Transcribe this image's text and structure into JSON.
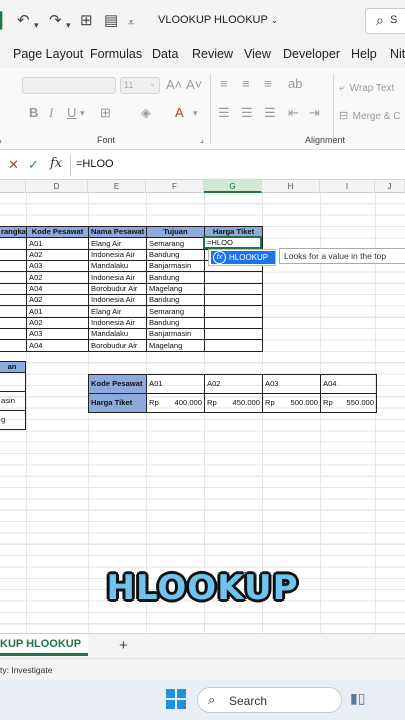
{
  "title_bar": {
    "doc_title": "VLOOKUP HLOOKUP",
    "search_icon": "search-icon"
  },
  "ribbon_tabs": [
    "Page Layout",
    "Formulas",
    "Data",
    "Review",
    "View",
    "Developer",
    "Help",
    "Nit"
  ],
  "ribbon": {
    "font_size_value": "11",
    "wrap_text_label": "Wrap Text",
    "merge_label": "Merge & C",
    "groups": {
      "font": "Font",
      "alignment": "Alignment"
    }
  },
  "formula_bar": {
    "content": "=HLOO"
  },
  "columns": [
    "D",
    "E",
    "F",
    "G",
    "H",
    "I",
    "J"
  ],
  "table1": {
    "headers": [
      "rangka",
      "Kode Pesawat",
      "Nama Pesawat",
      "Tujuan",
      "Harga Tiket"
    ],
    "rows": [
      [
        "A01",
        "Elang Air",
        "Semarang"
      ],
      [
        "A02",
        "Indonesia Air",
        "Bandung"
      ],
      [
        "A03",
        "Mandalaku",
        "Banjarmasin"
      ],
      [
        "A02",
        "Indonesia Air",
        "Bandung"
      ],
      [
        "A04",
        "Borobudur Air",
        "Magelang"
      ],
      [
        "A02",
        "Indonesia Air",
        "Bandung"
      ],
      [
        "A01",
        "Elang Air",
        "Semarang"
      ],
      [
        "A02",
        "Indonesia Air",
        "Bandung"
      ],
      [
        "A03",
        "Mandalaku",
        "Banjarmasin"
      ],
      [
        "A04",
        "Borobudur Air",
        "Magelang"
      ]
    ]
  },
  "active_cell_text": "=HLOO",
  "left_table": {
    "header": "an",
    "cells": [
      "",
      "asin",
      "g"
    ]
  },
  "table2": {
    "row1_label": "Kode Pesawat",
    "row2_label": "Harga Tiket",
    "codes": [
      "A01",
      "A02",
      "A03",
      "A04"
    ],
    "currency": "Rp",
    "prices": [
      "400.000",
      "450.000",
      "500.000",
      "550.000"
    ]
  },
  "autocomplete": {
    "item": "HLOOKUP",
    "tooltip": "Looks for a value in the top"
  },
  "caption": "HLOOKUP",
  "sheet_tab": "KUP HLOOKUP",
  "status_text": "ty: Investigate",
  "taskbar": {
    "search_label": "Search"
  }
}
